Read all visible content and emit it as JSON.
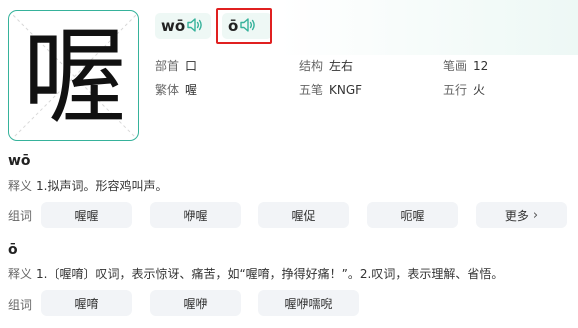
{
  "character": "喔",
  "pronunciations": [
    {
      "pinyin": "wō",
      "speaker_icon": "speaker-icon"
    },
    {
      "pinyin": "ō",
      "speaker_icon": "speaker-icon"
    }
  ],
  "info": {
    "radical": {
      "label": "部首",
      "value": "口"
    },
    "structure": {
      "label": "结构",
      "value": "左右"
    },
    "strokes": {
      "label": "笔画",
      "value": "12"
    },
    "traditional": {
      "label": "繁体",
      "value": "喔"
    },
    "wubi": {
      "label": "五笔",
      "value": "KNGF"
    },
    "five_elements": {
      "label": "五行",
      "value": "火"
    }
  },
  "senses": [
    {
      "pinyin": "wō",
      "definition_label": "释义",
      "definition": "1.拟声词。形容鸡叫声。",
      "words_label": "组词",
      "words": [
        "喔喔",
        "咿喔",
        "喔促",
        "呃喔"
      ],
      "more_label": "更多"
    },
    {
      "pinyin": "ō",
      "definition_label": "释义",
      "definition": "1.〔喔唷〕叹词，表示惊讶、痛苦，如“喔唷，挣得好痛！”。2.叹词，表示理解、省悟。",
      "words_label": "组词",
      "words": [
        "喔唷",
        "喔咿",
        "喔咿嚅唲"
      ]
    }
  ],
  "colors": {
    "accent": "#36b29b",
    "highlight_box": "#e02020",
    "chip_bg": "#f2f4f7"
  }
}
